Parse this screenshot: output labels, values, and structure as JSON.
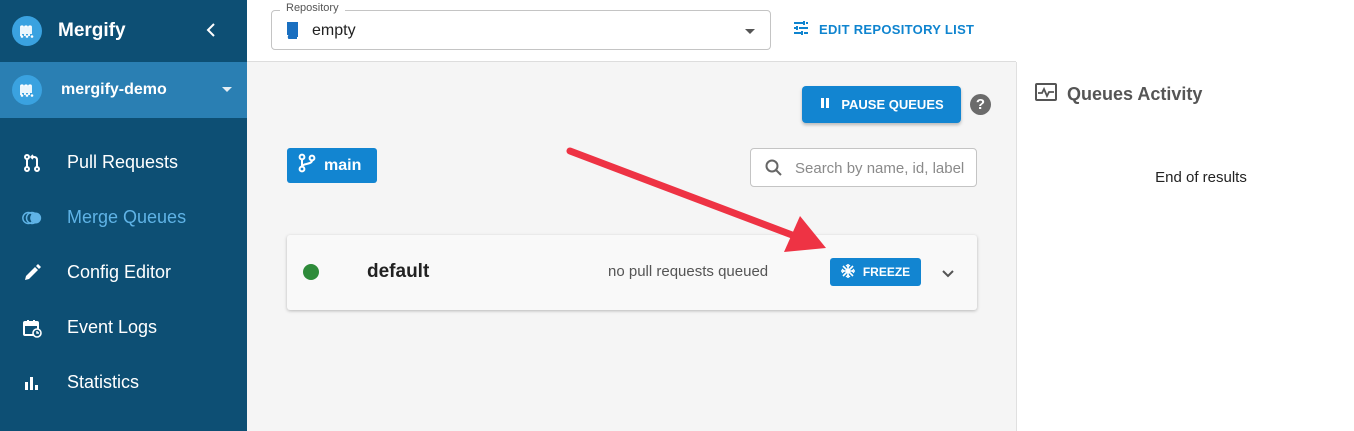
{
  "sidebar": {
    "brand": "Mergify",
    "org": "mergify-demo",
    "items": [
      {
        "label": "Pull Requests",
        "icon": "pull-request-icon"
      },
      {
        "label": "Merge Queues",
        "icon": "merge-queue-icon",
        "active": true
      },
      {
        "label": "Config Editor",
        "icon": "pencil-icon"
      },
      {
        "label": "Event Logs",
        "icon": "calendar-history-icon"
      },
      {
        "label": "Statistics",
        "icon": "bar-chart-icon"
      }
    ]
  },
  "topbar": {
    "repo_label": "Repository",
    "repo_value": "empty",
    "edit_link": "EDIT REPOSITORY LIST"
  },
  "main": {
    "pause_label": "PAUSE QUEUES",
    "help_glyph": "?",
    "branch": "main",
    "search_placeholder": "Search by name, id, label",
    "queue": {
      "name": "default",
      "status": "no pull requests queued",
      "freeze_label": "FREEZE"
    }
  },
  "activity": {
    "title": "Queues Activity",
    "end_text": "End of results"
  },
  "colors": {
    "sidebar": "#0d4f74",
    "org_bar": "#2a7fb3",
    "primary": "#1285d1",
    "status_green": "#2e8b3a",
    "annotation_arrow": "#ee3344"
  }
}
